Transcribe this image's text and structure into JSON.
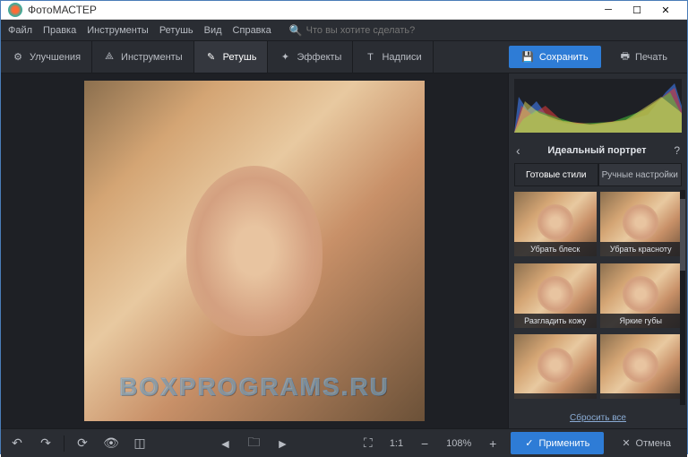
{
  "window": {
    "title": "ФотоМАСТЕР"
  },
  "menu": {
    "file": "Файл",
    "edit": "Правка",
    "tools": "Инструменты",
    "retouch": "Ретушь",
    "view": "Вид",
    "help": "Справка",
    "search_placeholder": "Что вы хотите сделать?"
  },
  "tabs": {
    "enhance": "Улучшения",
    "tools": "Инструменты",
    "retouch": "Ретушь",
    "effects": "Эффекты",
    "text": "Надписи"
  },
  "actions": {
    "save": "Сохранить",
    "print": "Печать"
  },
  "panel": {
    "title": "Идеальный портрет",
    "tab_styles": "Готовые стили",
    "tab_manual": "Ручные настройки",
    "reset": "Сбросить все"
  },
  "presets": [
    {
      "label": "Убрать блеск"
    },
    {
      "label": "Убрать красноту"
    },
    {
      "label": "Разгладить кожу"
    },
    {
      "label": "Яркие губы"
    },
    {
      "label": ""
    },
    {
      "label": ""
    }
  ],
  "bottom": {
    "ratio": "1:1",
    "zoom": "108%",
    "apply": "Применить",
    "cancel": "Отмена"
  },
  "watermark": "BOXPROGRAMS.RU"
}
